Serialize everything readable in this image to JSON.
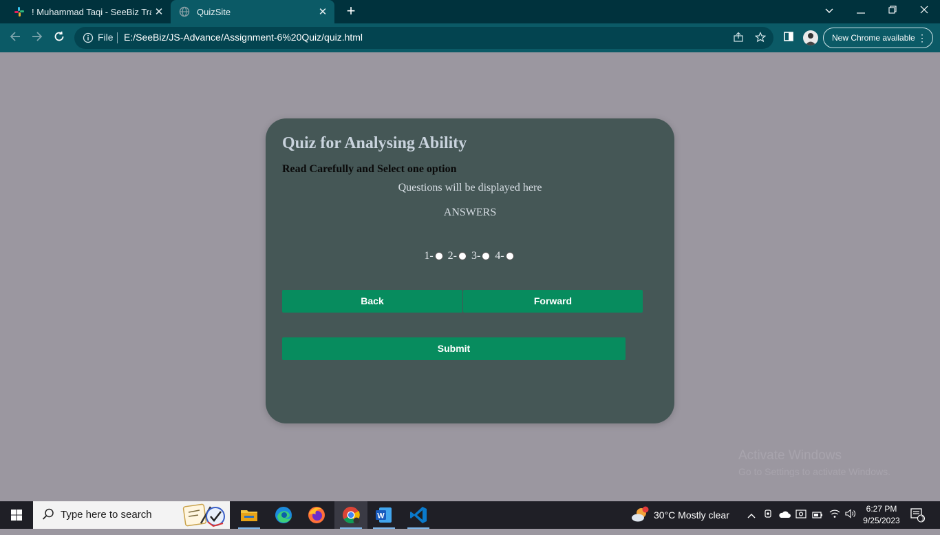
{
  "browser": {
    "tabs": [
      {
        "title": "! Muhammad Taqi - SeeBiz Trainin",
        "active": false,
        "icon": "slack-icon"
      },
      {
        "title": "QuizSite",
        "active": true,
        "icon": "globe-icon"
      }
    ],
    "new_tab_label": "+",
    "window_controls": {
      "minimize": "—",
      "restore": "❐",
      "close": "✕",
      "tab_search": "⌄"
    },
    "omnibox": {
      "scheme_label": "File",
      "url": "E:/SeeBiz/JS-Advance/Assignment-6%20Quiz/quiz.html"
    },
    "update_button": "New Chrome available",
    "accent": "#0b5a66"
  },
  "quiz": {
    "title": "Quiz for Analysing Ability",
    "subtitle": "Read Carefully and Select one option",
    "question": "Questions will be displayed here",
    "answers_heading": "ANSWERS",
    "options": [
      "1-",
      "2-",
      "3-",
      "4-"
    ],
    "back_label": "Back",
    "forward_label": "Forward",
    "submit_label": "Submit",
    "button_color": "#078c5e",
    "card_color": "#455756"
  },
  "watermark": {
    "line1": "Activate Windows",
    "line2": "Go to Settings to activate Windows."
  },
  "taskbar": {
    "search_placeholder": "Type here to search",
    "weather": "30°C  Mostly clear",
    "time": "6:27 PM",
    "date": "9/25/2023",
    "notification_count": "1",
    "weather_badge": "1"
  }
}
